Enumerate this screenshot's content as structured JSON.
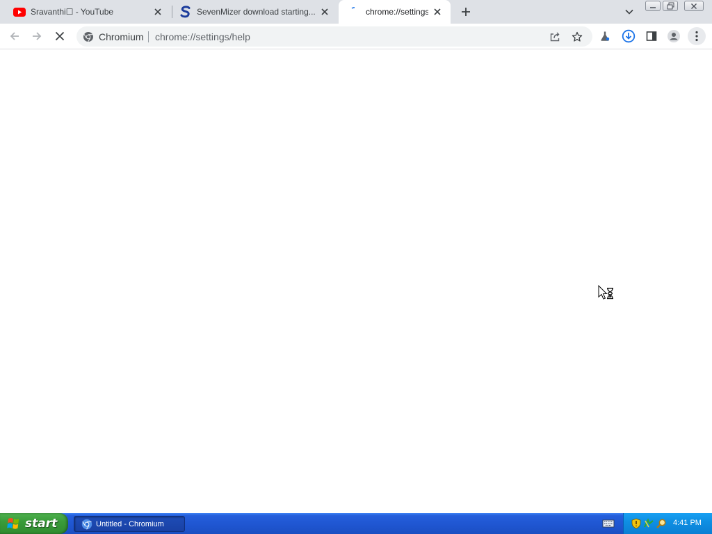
{
  "browser": {
    "tabs": [
      {
        "title": "Sravanthi☐ - YouTube",
        "favicon": "youtube-icon",
        "active": false
      },
      {
        "title": "SevenMizer download starting...",
        "favicon": "sevenmizer-icon",
        "active": false
      },
      {
        "title": "chrome://settings/help",
        "favicon": "loading-icon",
        "active": true
      }
    ],
    "omnibox": {
      "site_chip": "Chromium",
      "url": "chrome://settings/help"
    },
    "toolbar_icons": [
      "back-icon",
      "forward-icon",
      "stop-icon",
      "share-icon",
      "bookmark-star-icon",
      "labs-flask-icon",
      "download-icon",
      "side-panel-icon",
      "profile-icon",
      "menu-icon"
    ]
  },
  "taskbar": {
    "start_label": "start",
    "items": [
      {
        "label": "Untitled - Chromium",
        "icon": "chromium-icon"
      }
    ],
    "clock": "4:41 PM"
  },
  "colors": {
    "accent_blue": "#1a73e8",
    "youtube_red": "#ff0000",
    "xp_taskbar": "#245edb",
    "xp_start_green": "#3a9b3a",
    "xp_tray": "#0f8fe3"
  }
}
